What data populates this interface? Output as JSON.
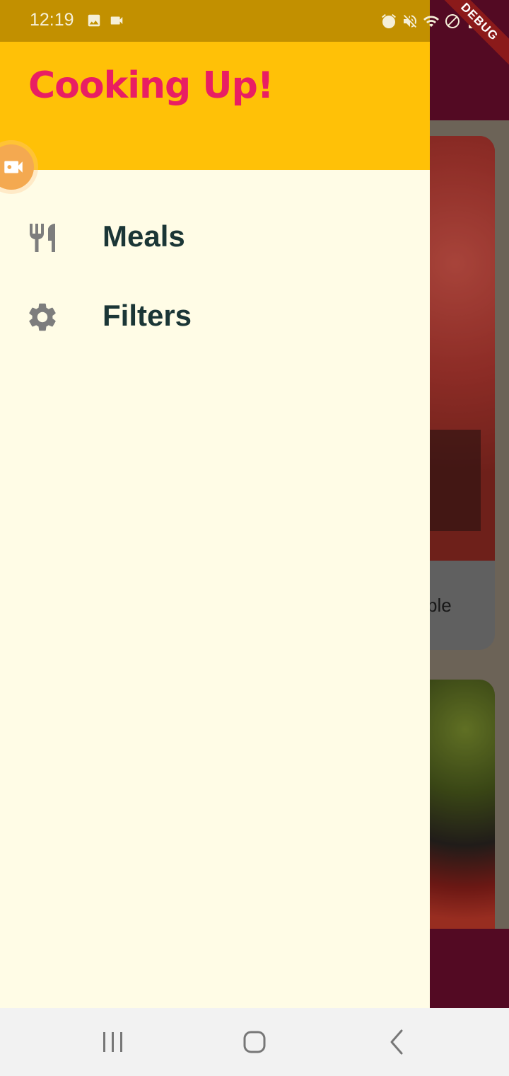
{
  "status_bar": {
    "time": "12:19",
    "debug_label": "DEBUG"
  },
  "drawer": {
    "title": "Cooking Up!",
    "items": [
      {
        "label": "Meals",
        "icon": "restaurant-icon"
      },
      {
        "label": "Filters",
        "icon": "settings-icon"
      }
    ]
  },
  "background": {
    "card_caption_fragment": "ple"
  },
  "colors": {
    "drawer_header": "#ffc107",
    "title_accent": "#e91e63",
    "drawer_bg": "#fffce6",
    "app_bar": "#6b0e2e",
    "menu_text": "#1b3636"
  }
}
